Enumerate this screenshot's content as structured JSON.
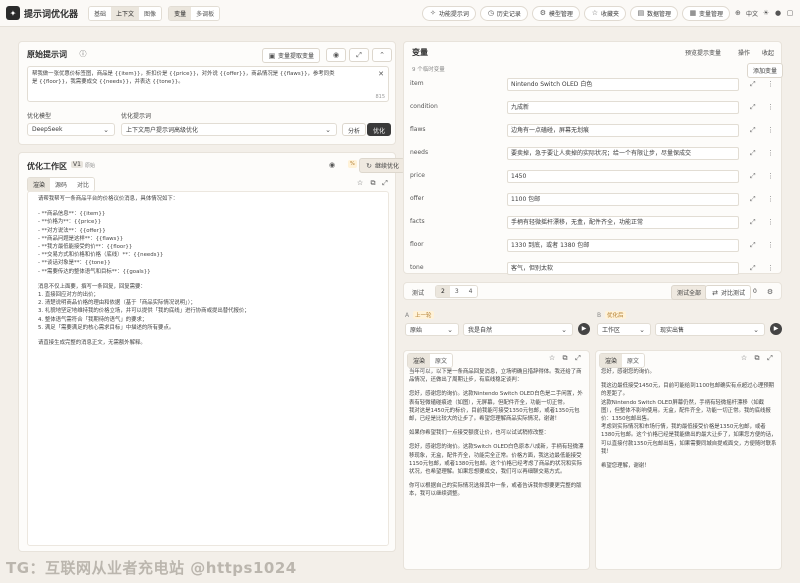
{
  "header": {
    "logo": "✦",
    "brand": "提示词优化器",
    "mode_tabs": [
      "基础",
      "上下文",
      "图像"
    ],
    "sub_tabs": [
      "变量",
      "多调板"
    ],
    "actions": [
      "功能提示词",
      "历史记录",
      "模型管理",
      "收藏夹",
      "数据管理",
      "变量管理"
    ],
    "lang": "中文"
  },
  "original": {
    "title": "原始提示词",
    "toolbar_btn": "变量提取变量",
    "text_line1": "帮我做一张优惠价标签图，商品是 {{item}}，折扣价是 {{price}}，对外说 {{offer}}，商品情况是 {{flaws}}，参考同类",
    "text_line2": "是 {{floor}}，我需要成交 {{needs}}，并表达 {{tone}}。",
    "count": "815",
    "model_label": "优化模型",
    "model_value": "DeepSeek",
    "template_label": "优化提示词",
    "template_value": "上下文用户提示词高级优化",
    "analyze_btn": "分析",
    "optimize_btn": "优化"
  },
  "workspace": {
    "title": "优化工作区",
    "version": "V1",
    "version_note": "原始",
    "compare_btn": "继续优化",
    "tabs": [
      "渲染",
      "源码",
      "对比"
    ],
    "lines": [
      "请帮我帮写一条商品平台的价格议价消息，具体情况如下：",
      "",
      "- **商品信息**：{{item}}",
      "- **价格为**：{{price}}",
      "- **对方说法**：{{offer}}",
      "- **商品问题是这样**：{{flaws}}",
      "- **我方最低能接受的价**：{{floor}}",
      "- **交易方式和价格和价格（底线）**：{{needs}}",
      "- **谈话对象是**：{{tone}}",
      "- **需要传达的整体语气和目标**：{{goals}}",
      "",
      "消息不仅上面要，撰写一条回复，回复需要：",
      "1. 直接回应对方的出价；",
      "2. 清楚说明商品价格的理由和依据（基于「商品实际情况说明」）；",
      "3. 礼貌地坚定地维持我的价格立场，并可以提供「我的底线」进行协商或提出替代报价；",
      "4. 整体语气需符合「我期待的语气」的要求；",
      "5. 满足「需要满足的核心需求目标」中描述的所有要点。",
      "",
      "请直接生成完整的消息正文，无需额外解释。"
    ]
  },
  "vars": {
    "title": "变量",
    "count": "9 个临时变量",
    "add_btn": "添加变量",
    "tabs": [
      "预览提示变量",
      "操作",
      "收起"
    ],
    "items": [
      {
        "name": "item",
        "value": "Nintendo Switch OLED 白色"
      },
      {
        "name": "condition",
        "value": "九成新"
      },
      {
        "name": "flaws",
        "value": "边角有一点磕碰，屏幕无划痕"
      },
      {
        "name": "needs",
        "value": "要卖掉，急于要让人卖掉的实际状况；给一个有限让步，尽量保成交"
      },
      {
        "name": "price",
        "value": "1450"
      },
      {
        "name": "offer",
        "value": "1100 包邮"
      },
      {
        "name": "facts",
        "value": "手柄有轻微摇杆漂移，无盒，配件齐全，功能正常"
      },
      {
        "name": "floor",
        "value": "1330 到底，或者 1380 包邮"
      },
      {
        "name": "tone",
        "value": "客气，但别太软"
      }
    ]
  },
  "compare": {
    "label": "测试",
    "pages": [
      "2",
      "3",
      "4"
    ],
    "btn_compare": "测试全部",
    "btn_manual": "对比测试",
    "count": "0",
    "a_label": "A",
    "a_name": "上一轮",
    "b_label": "B",
    "b_name": "优化后",
    "a_model": "原始",
    "a_template": "我是自然",
    "b_model": "工作区",
    "b_template": "现实出售",
    "a_tabs": [
      "渲染",
      "原文"
    ],
    "b_tabs": [
      "渲染",
      "原文"
    ],
    "a_text": [
      "当年可以，以下是一条商品回复消息，立场明确且措辞得体。我还给了商品情况，还做出了周期让步，有底线稳定谈判：",
      "",
      "您好，感谢您的询价。这款Nintendo Switch OLED白色是二手闲置，外表有轻微磕碰痕迹（如图），无屏幕，但配件齐全，功能一切正常。",
      "我对这是1450元的标价，目前我能可接受1350元包邮，或者1350元包邮，已经是比较大的让步了。希望您理解商品实际情况，谢谢！",
      "",
      "如果你希望我们一点接受额度让价，也可以试试稍修改整：",
      "",
      "您好，感谢您的询价。这款Switch OLED白色原本八成新，手柄有轻微漂移现象，无盒，配件齐全，功能完全正常。价格方面，我这边最低能接受1150元包邮，或者1380元包邮。这个价格已经考虑了商品的状况和实际状况，也希望理解。如果您想要成交，我们可以再细聊交易方式。",
      "",
      "你可以根据自己的实际情况选择其中一条，或者告诉我你想要更完整的版本，我可以继续调整。"
    ],
    "b_text": [
      "您好，感谢您的询价。",
      "",
      "我这边最低接受1450元，目前可能给到1100包邮确实有点超过心理预期的差距了。",
      "这款Nintendo Switch OLED屏幕仍然，手柄有轻微摇杆漂移（如截图），但整体不影响使用。无盒，配件齐全，功能一切正常。我的底线报价：1350包邮出售。",
      "考虑到实际情况和市场行情，我的最低接受价格是1350元包邮，或者1380元包邮。这个价格已经是我能做出的最大让步了，如果您方便的话，可以直接付款1350元包邮出售，如果需要同城自提或面交，方便随时联系我！",
      "",
      "希望您理解，谢谢！"
    ]
  },
  "watermark": "TG：互联网从业者充电站 @https1024"
}
